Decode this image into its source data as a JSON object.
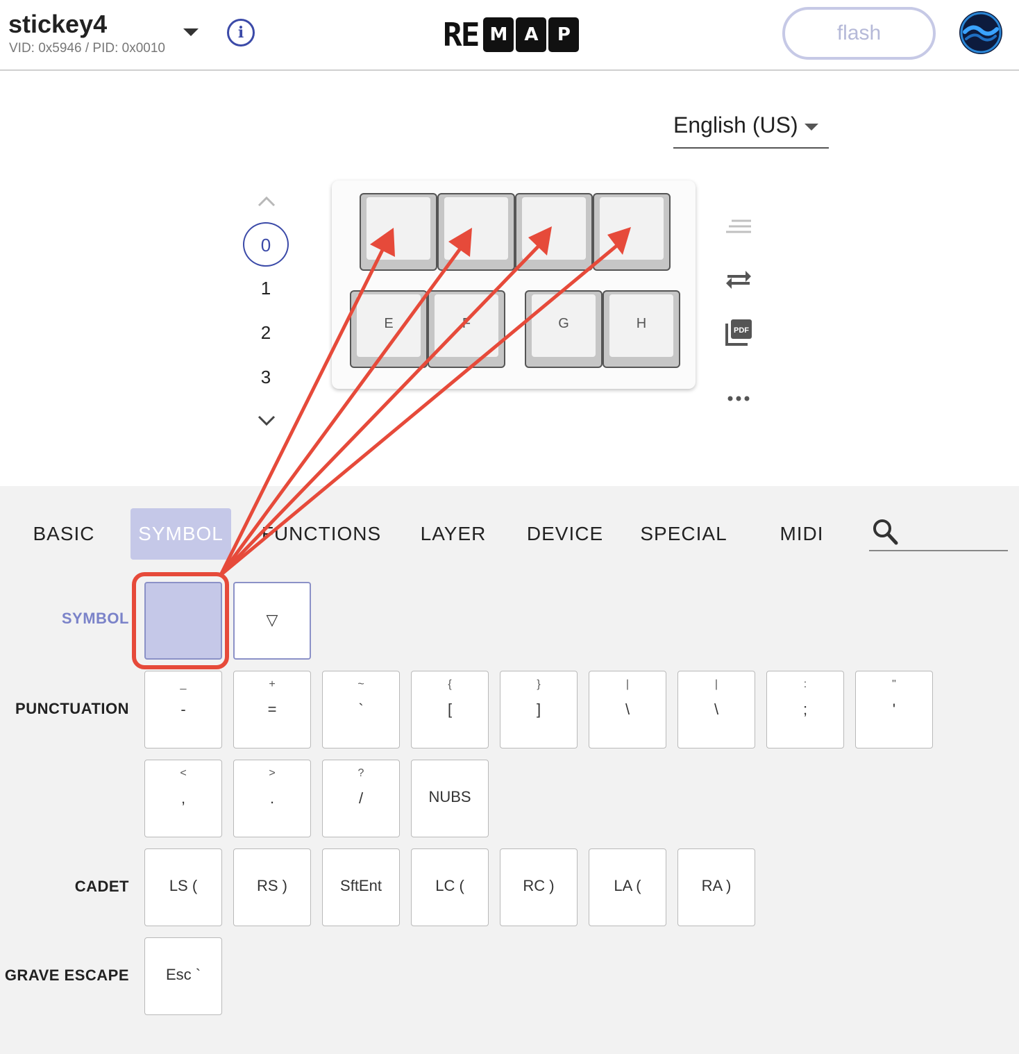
{
  "header": {
    "keyboard_name": "stickey4",
    "keyboard_ids": "VID: 0x5946 / PID: 0x0010",
    "info_icon": "i",
    "logo": {
      "plain": "RE",
      "boxed": [
        "M",
        "A",
        "P"
      ]
    },
    "flash_label": "flash"
  },
  "language": {
    "label": "English (US)"
  },
  "layers": {
    "items": [
      "0",
      "1",
      "2",
      "3"
    ],
    "active_index": 0
  },
  "keyboard": {
    "keys": [
      "",
      "",
      "",
      "",
      "E",
      "F",
      "G",
      "H"
    ]
  },
  "tabs": [
    "BASIC",
    "SYMBOL",
    "FUNCTIONS",
    "LAYER",
    "DEVICE",
    "SPECIAL",
    "MIDI"
  ],
  "active_tab": "SYMBOL",
  "categories": {
    "symbol": {
      "label": "SYMBOL",
      "keys": [
        "",
        "▽"
      ]
    },
    "punctuation": {
      "label": "PUNCTUATION",
      "row1": [
        {
          "top": "_",
          "bottom": "-"
        },
        {
          "top": "+",
          "bottom": "="
        },
        {
          "top": "~",
          "bottom": "`"
        },
        {
          "top": "{",
          "bottom": "["
        },
        {
          "top": "}",
          "bottom": "]"
        },
        {
          "top": "|",
          "bottom": "\\"
        },
        {
          "top": "|",
          "bottom": "\\"
        },
        {
          "top": ":",
          "bottom": ";"
        },
        {
          "top": "\"",
          "bottom": "'"
        }
      ],
      "row2": [
        {
          "top": "<",
          "bottom": ","
        },
        {
          "top": ">",
          "bottom": "."
        },
        {
          "top": "?",
          "bottom": "/"
        },
        {
          "top": "",
          "bottom": "NUBS"
        }
      ]
    },
    "cadet": {
      "label": "CADET",
      "keys": [
        "LS (",
        "RS )",
        "SftEnt",
        "LC (",
        "RC )",
        "LA (",
        "RA )"
      ]
    },
    "grave_escape": {
      "label": "GRAVE ESCAPE",
      "keys": [
        "Esc `"
      ]
    }
  },
  "colors": {
    "accent": "#3b4aa8",
    "selected": "#c5c8e8",
    "annotation": "#e64a3a"
  },
  "icons": [
    "info-icon",
    "chevron-up-icon",
    "chevron-down-icon",
    "menu-lines-icon",
    "swap-arrows-icon",
    "pdf-icon",
    "more-dots-icon",
    "search-icon",
    "user-avatar-icon"
  ]
}
